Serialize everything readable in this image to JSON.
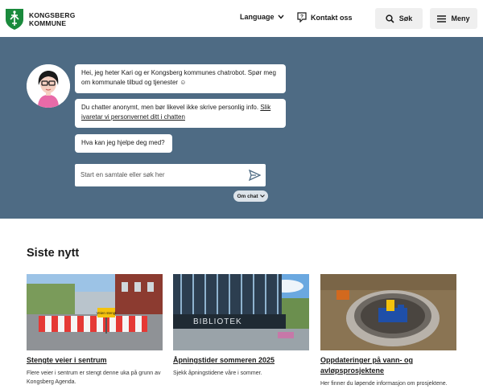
{
  "header": {
    "logo_line1": "KONGSBERG",
    "logo_line2": "KOMMUNE",
    "language_label": "Language",
    "contact_label": "Kontakt oss",
    "search_label": "Søk",
    "menu_label": "Meny"
  },
  "chat": {
    "bubble1": "Hei, jeg heter Kari og er Kongsberg kommunes chatrobot. Spør meg om kommunale tilbud og tjenester ☺",
    "bubble2_text": "Du chatter anonymt, men bør likevel ikke skrive personlig info. ",
    "bubble2_link": "Slik ivaretar vi personvernet ditt i chatten",
    "bubble3": "Hva kan jeg hjelpe deg med?",
    "input_placeholder": "Start en samtale eller søk her",
    "about_label": "Om chat"
  },
  "news": {
    "title": "Siste nytt",
    "items": [
      {
        "title": "Stengte veier i sentrum",
        "text": "Flere veier i sentrum er stengt denne uka på grunn av Kongsberg Agenda."
      },
      {
        "title": "Åpningstider sommeren 2025",
        "text": "Sjekk åpningstidene våre i sommer."
      },
      {
        "title": "Oppdateringer på vann- og avløpsprosjektene",
        "text": "Her finner du løpende informasjon om prosjektene."
      }
    ],
    "image2_sign": "BIBLIOTEK",
    "image1_sign": "Veien stengt"
  },
  "colors": {
    "hero_bg": "#4e6b84",
    "logo_green": "#1a8a3c"
  }
}
